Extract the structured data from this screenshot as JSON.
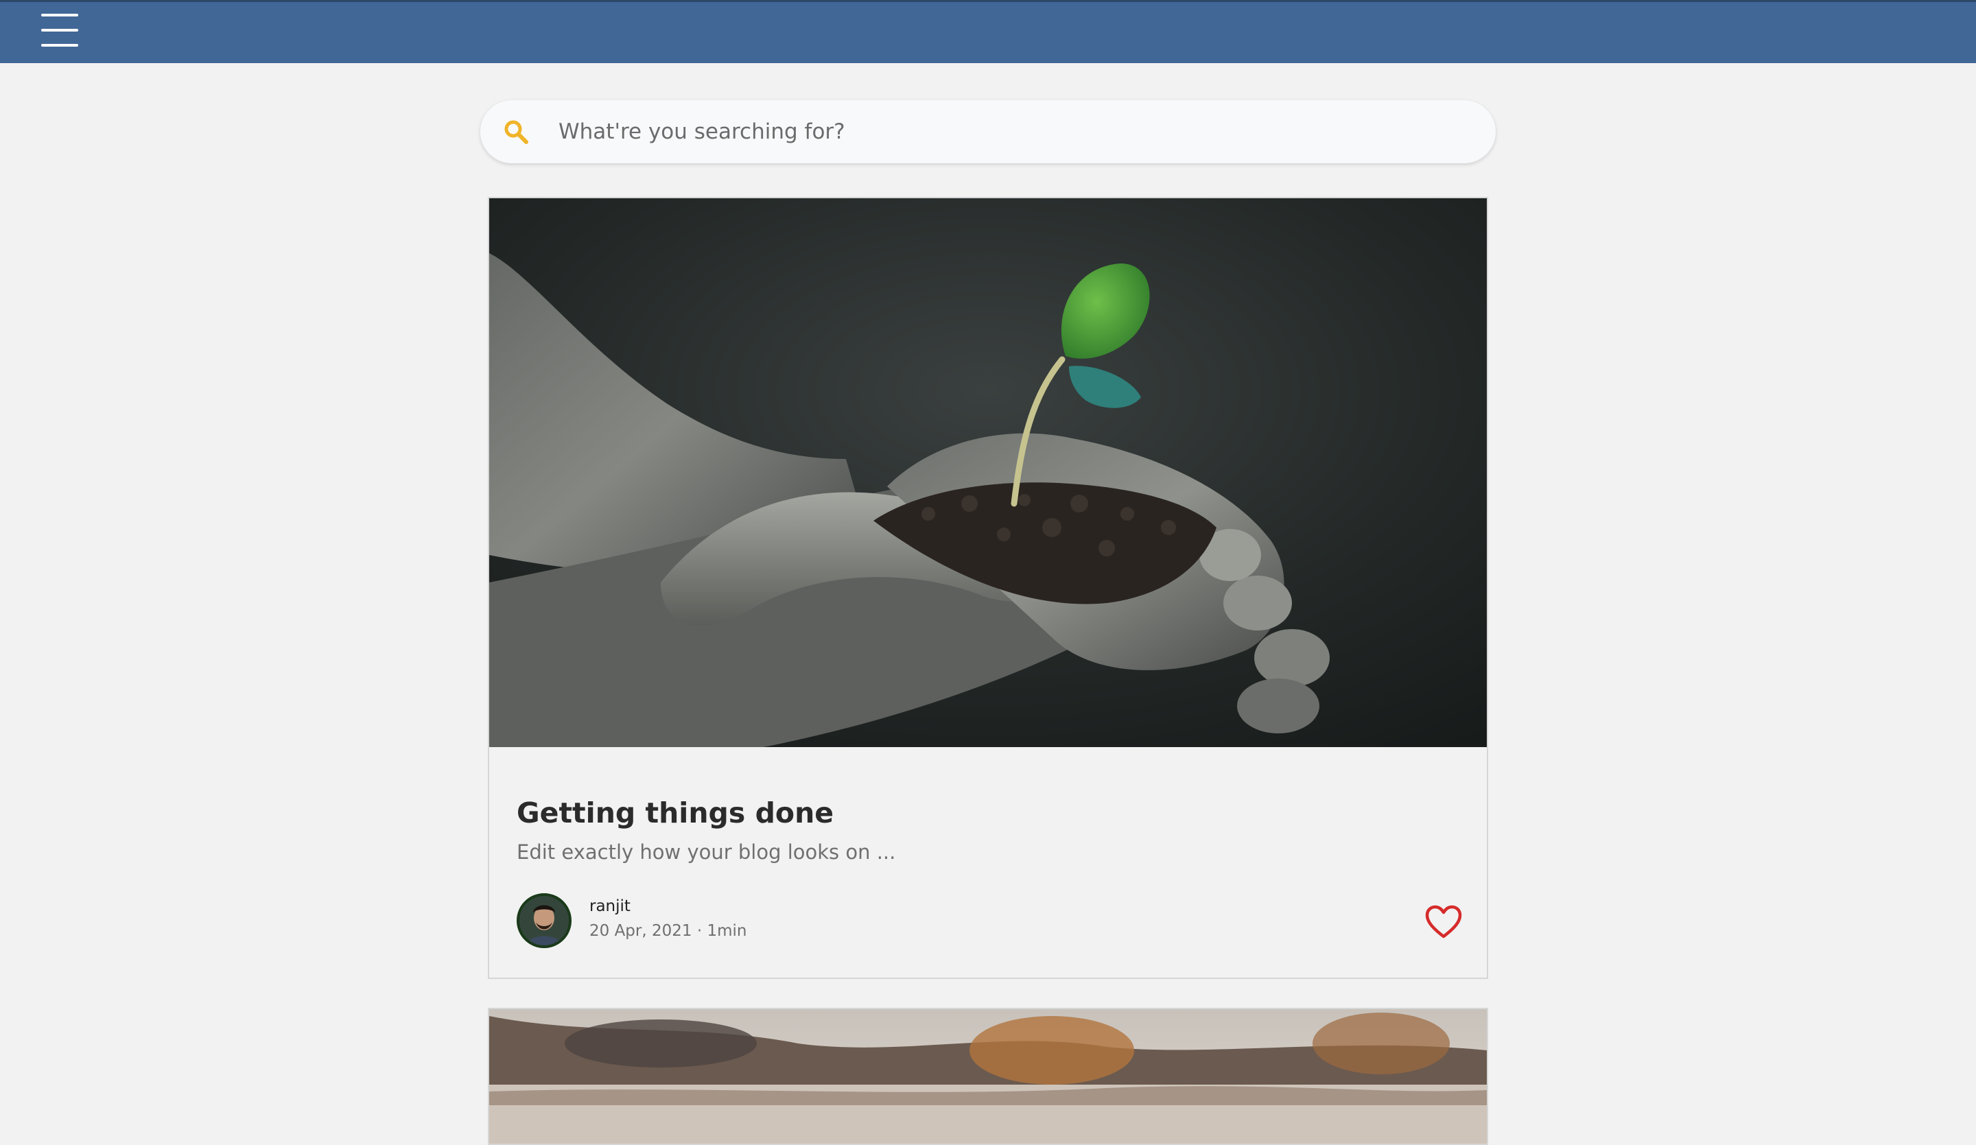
{
  "topbar": {
    "background": "#416797",
    "menu_icon": "hamburger-menu-icon"
  },
  "search": {
    "placeholder": "What're you searching for?",
    "value": "",
    "icon": "search-icon",
    "icon_color": "#f0b429"
  },
  "posts": [
    {
      "title": "Getting things done",
      "excerpt": "Edit exactly how your blog looks on ...",
      "image": "hands holding soil with green seedling",
      "author": "ranjit",
      "date": "20 Apr, 2021",
      "read_time": "1min",
      "meta": "20 Apr, 2021 · 1min",
      "like_icon": "heart-outline-icon",
      "like_color": "#d62b2b"
    },
    {
      "image": "blurred lake landscape with trees"
    }
  ]
}
